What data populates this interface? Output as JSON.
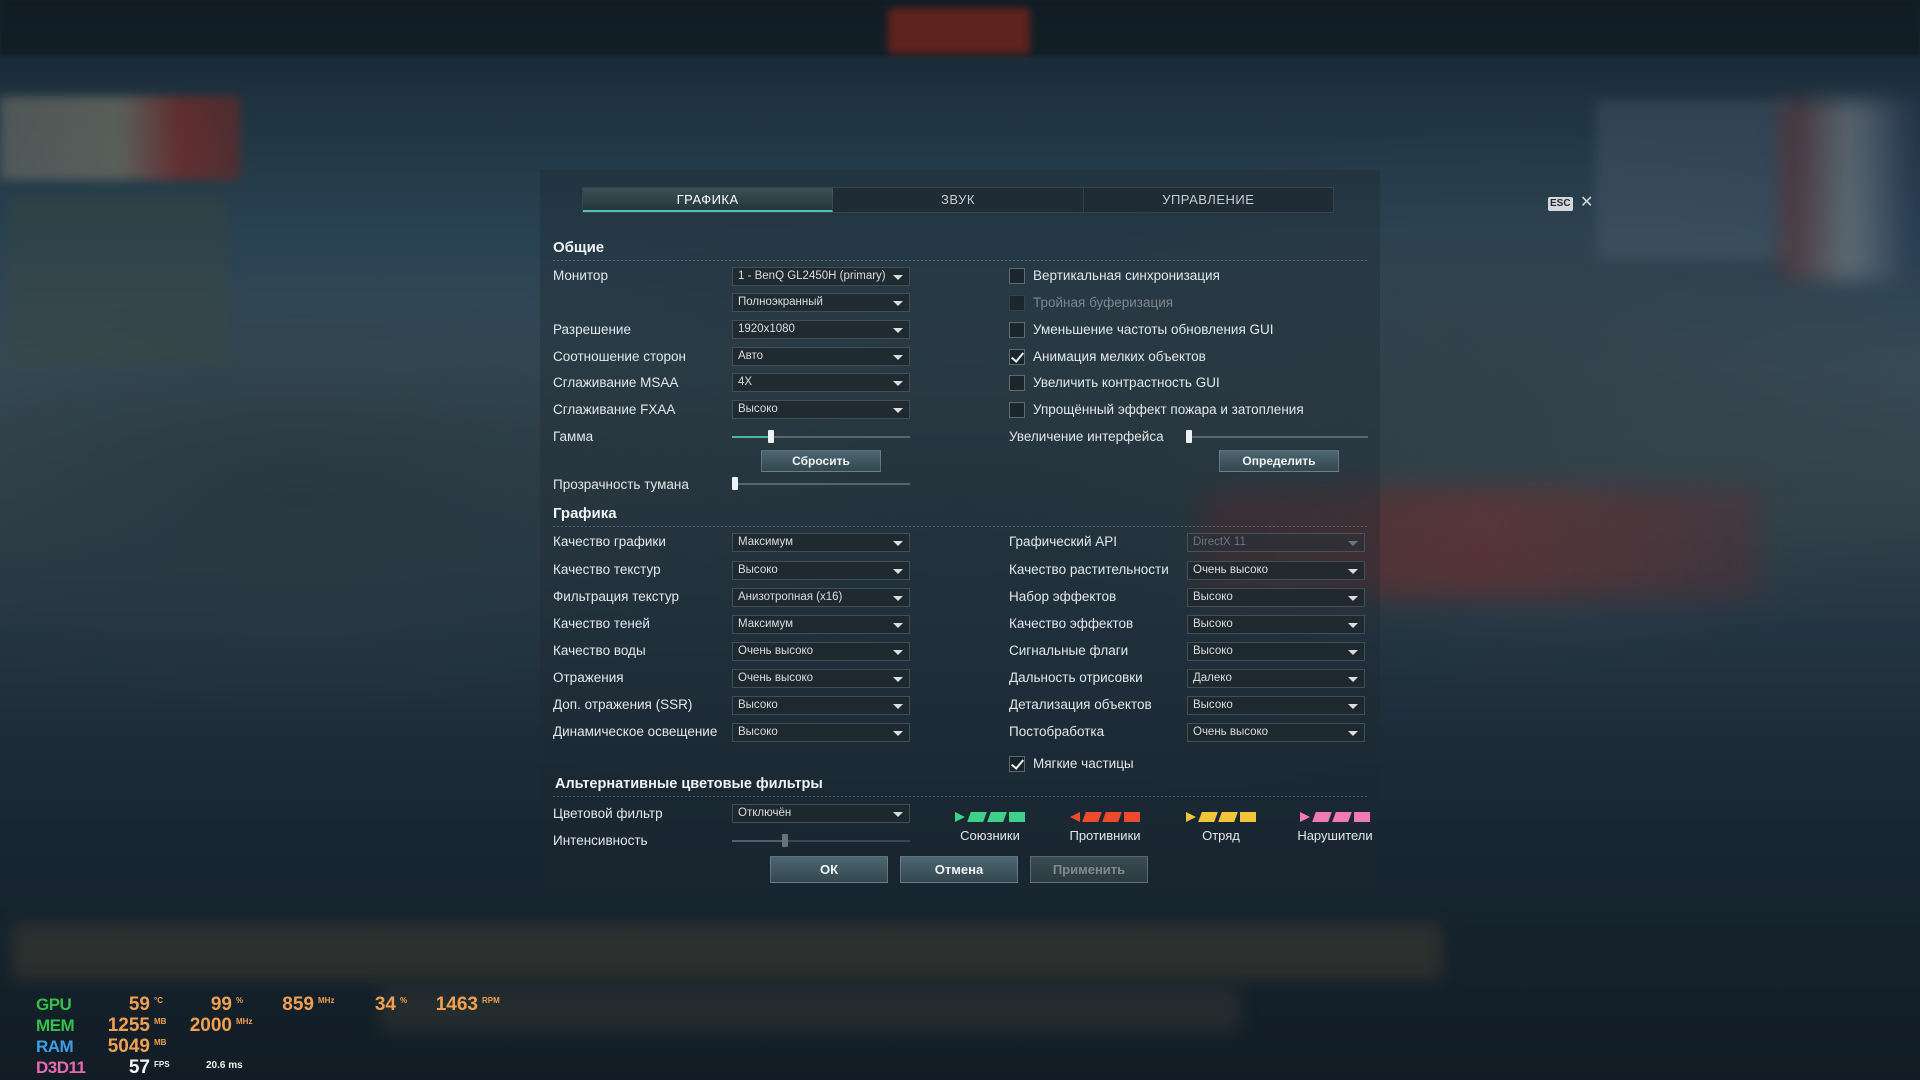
{
  "tabs": [
    {
      "label": "ГРАФИКА",
      "active": true
    },
    {
      "label": "ЗВУК",
      "active": false
    },
    {
      "label": "УПРАВЛЕНИЕ",
      "active": false
    }
  ],
  "esc_label": "ESC",
  "close_glyph": "✕",
  "sections": {
    "general": "Общие",
    "graphics": "Графика",
    "color_filters": "Альтернативные цветовые фильтры"
  },
  "general": {
    "monitor_label": "Монитор",
    "monitor_value": "1 - BenQ GL2450H (primary)",
    "mode_value": "Полноэкранный",
    "resolution_label": "Разрешение",
    "resolution_value": "1920x1080",
    "aspect_label": "Соотношение сторон",
    "aspect_value": "Авто",
    "msaa_label": "Сглаживание MSAA",
    "msaa_value": "4X",
    "fxaa_label": "Сглаживание FXAA",
    "fxaa_value": "Высоко",
    "gamma_label": "Гамма",
    "gamma_level": 0.22,
    "reset_button": "Сбросить",
    "fog_label": "Прозрачность тумана",
    "fog_level": 0.0,
    "checkboxes": [
      {
        "label": "Вертикальная синхронизация",
        "checked": false,
        "disabled": false
      },
      {
        "label": "Тройная буферизация",
        "checked": false,
        "disabled": true
      },
      {
        "label": "Уменьшение частоты обновления GUI",
        "checked": false,
        "disabled": false
      },
      {
        "label": "Анимация мелких объектов",
        "checked": true,
        "disabled": false
      },
      {
        "label": "Увеличить контрастность GUI",
        "checked": false,
        "disabled": false
      },
      {
        "label": "Упрощённый эффект пожара и затопления",
        "checked": false,
        "disabled": false
      }
    ],
    "ui_scale_label": "Увеличение интерфейса",
    "ui_scale_level": 0.0,
    "detect_button": "Определить"
  },
  "graphics_left": [
    {
      "label": "Качество графики",
      "value": "Максимум"
    },
    {
      "label": "Качество текстур",
      "value": "Высоко"
    },
    {
      "label": "Фильтрация текстур",
      "value": "Анизотропная (x16)"
    },
    {
      "label": "Качество теней",
      "value": "Максимум"
    },
    {
      "label": "Качество воды",
      "value": "Очень высоко"
    },
    {
      "label": "Отражения",
      "value": "Очень высоко"
    },
    {
      "label": "Доп. отражения (SSR)",
      "value": "Высоко"
    },
    {
      "label": "Динамическое освещение",
      "value": "Высоко"
    }
  ],
  "graphics_right": [
    {
      "label": "Графический API",
      "value": "DirectX 11",
      "disabled": true
    },
    {
      "label": "Качество растительности",
      "value": "Очень высоко",
      "disabled": false
    },
    {
      "label": "Набор эффектов",
      "value": "Высоко",
      "disabled": false
    },
    {
      "label": "Качество эффектов",
      "value": "Высоко",
      "disabled": false
    },
    {
      "label": "Сигнальные флаги",
      "value": "Высоко",
      "disabled": false
    },
    {
      "label": "Дальность отрисовки",
      "value": "Далеко",
      "disabled": false
    },
    {
      "label": "Детализация объектов",
      "value": "Высоко",
      "disabled": false
    },
    {
      "label": "Постобработка",
      "value": "Очень высоко",
      "disabled": false
    }
  ],
  "soft_particles": {
    "label": "Мягкие частицы",
    "checked": true
  },
  "color_filter": {
    "filter_label": "Цветовой фильтр",
    "filter_value": "Отключён",
    "intensity_label": "Интенсивность",
    "intensity_level": 0.3,
    "groups": [
      {
        "name": "Союзники",
        "color": "#3fd08a"
      },
      {
        "name": "Противники",
        "color": "#ee4a2e"
      },
      {
        "name": "Отряд",
        "color": "#f2c43a"
      },
      {
        "name": "Нарушители",
        "color": "#f07ab4"
      }
    ]
  },
  "buttons": {
    "ok": "ОК",
    "cancel": "Отмена",
    "apply": "Применить"
  },
  "hw_monitor": {
    "gpu_label": "GPU",
    "mem_label": "MEM",
    "ram_label": "RAM",
    "api_label": "D3D11",
    "gpu_temp": "59",
    "gpu_temp_unit": "°C",
    "gpu_load": "99",
    "gpu_load_unit": "%",
    "gpu_clock": "859",
    "gpu_clock_unit": "MHz",
    "fan_pct": "34",
    "fan_pct_unit": "%",
    "fan_rpm": "1463",
    "fan_rpm_unit": "RPM",
    "mem_used": "1255",
    "mem_used_unit": "MB",
    "mem_clock": "2000",
    "mem_clock_unit": "MHz",
    "ram_used": "5049",
    "ram_used_unit": "MB",
    "fps": "57",
    "fps_unit": "FPS",
    "frametime": "20.6 ms"
  }
}
